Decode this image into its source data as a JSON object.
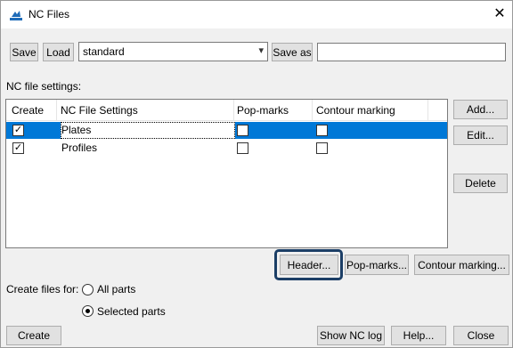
{
  "window": {
    "title": "NC Files",
    "close_glyph": "✕"
  },
  "toolbar": {
    "save_label": "Save",
    "load_label": "Load",
    "settings_value": "standard",
    "save_as_label": "Save as",
    "save_as_value": ""
  },
  "settings_label": "NC file settings:",
  "table": {
    "columns": [
      "Create",
      "NC File Settings",
      "Pop-marks",
      "Contour marking"
    ],
    "rows": [
      {
        "create": true,
        "name": "Plates",
        "pop_marks": false,
        "contour_marking": false,
        "selected": true
      },
      {
        "create": true,
        "name": "Profiles",
        "pop_marks": false,
        "contour_marking": false,
        "selected": false
      }
    ]
  },
  "side_buttons": {
    "add": "Add...",
    "edit": "Edit...",
    "delete": "Delete"
  },
  "lower_buttons": {
    "header": "Header...",
    "pop_marks": "Pop-marks...",
    "contour_marking": "Contour marking..."
  },
  "create_for": {
    "label": "Create files for:",
    "options": [
      {
        "label": "All parts",
        "selected": false
      },
      {
        "label": "Selected parts",
        "selected": true
      }
    ]
  },
  "bottom_buttons": {
    "create": "Create",
    "show_nc_log": "Show NC log",
    "help": "Help...",
    "close": "Close"
  },
  "icons": {
    "app": "nc-files-app-icon",
    "dropdown": "chevron-down-icon",
    "check": "checkmark-icon"
  },
  "colors": {
    "selection": "#0078d7",
    "highlight_border": "#1b3e66"
  }
}
